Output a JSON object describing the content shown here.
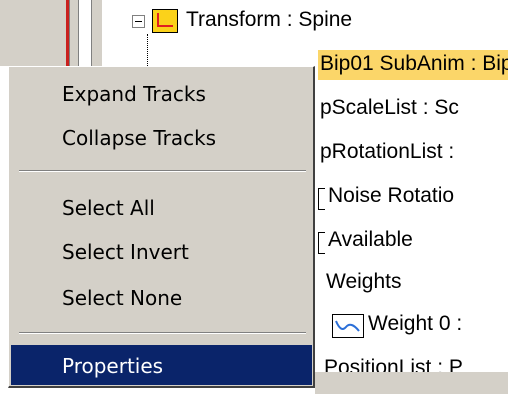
{
  "tree": {
    "rows": [
      {
        "label": "Transform : Spine"
      },
      {
        "label": "Bip01 SubAnim : Bip"
      },
      {
        "label": "pScaleList : Sc"
      },
      {
        "label": "pRotationList :"
      },
      {
        "label": "Noise Rotatio"
      },
      {
        "label": "Available"
      },
      {
        "label": "Weights"
      },
      {
        "label": "Weight 0 :"
      },
      {
        "label": "PositionList : P"
      }
    ]
  },
  "context_menu": {
    "items": [
      {
        "label": "Expand Tracks"
      },
      {
        "label": "Collapse Tracks"
      },
      {
        "label": "Select All"
      },
      {
        "label": "Select Invert"
      },
      {
        "label": "Select None"
      },
      {
        "label": "Properties",
        "selected": true
      }
    ]
  },
  "colors": {
    "menu_background": "#d4d0c8",
    "selection": "#0a246a",
    "track_highlight": "#fbd669",
    "accent_red": "#c9201e"
  }
}
